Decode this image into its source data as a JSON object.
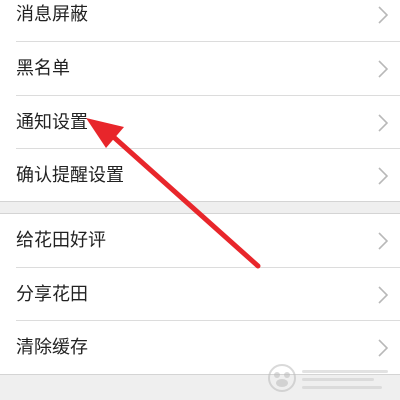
{
  "settings": {
    "group1": [
      {
        "label": "消息屏蔽"
      },
      {
        "label": "黑名单"
      },
      {
        "label": "通知设置"
      },
      {
        "label": "确认提醒设置"
      }
    ],
    "group2": [
      {
        "label": "给花田好评"
      },
      {
        "label": "分享花田"
      },
      {
        "label": "清除缓存"
      }
    ]
  },
  "annotation": {
    "arrow_color": "#e8262b",
    "target": "通知设置"
  },
  "colors": {
    "background": "#efefef",
    "row": "#ffffff",
    "text": "#222222",
    "chevron": "#b8b8b8",
    "divider": "#dcdcdc"
  }
}
